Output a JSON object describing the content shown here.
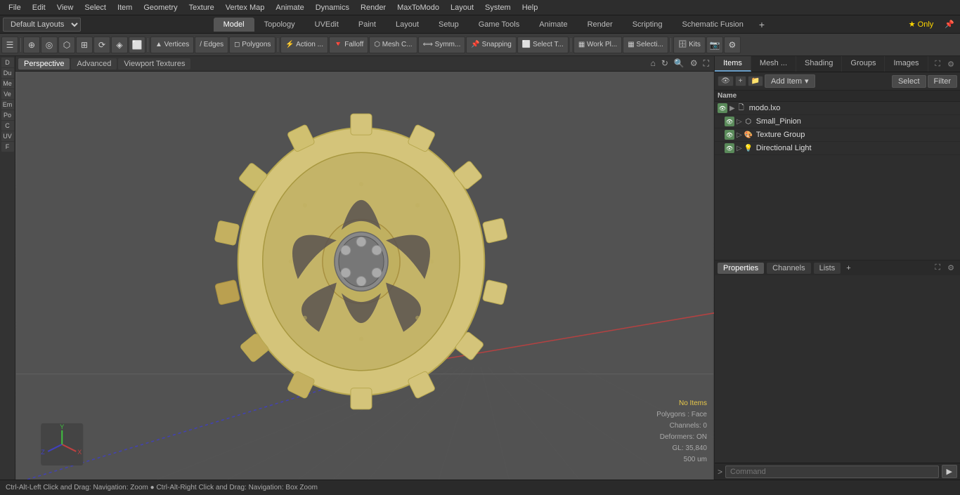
{
  "menubar": {
    "items": [
      "File",
      "Edit",
      "View",
      "Select",
      "Item",
      "Geometry",
      "Texture",
      "Vertex Map",
      "Animate",
      "Dynamics",
      "Render",
      "MaxToModo",
      "Layout",
      "System",
      "Help"
    ]
  },
  "layoutbar": {
    "preset": "Default Layouts",
    "tabs": [
      "Model",
      "Topology",
      "UVEdit",
      "Paint",
      "Layout",
      "Setup",
      "Game Tools",
      "Animate",
      "Render",
      "Scripting",
      "Schematic Fusion"
    ],
    "active_tab": "Model",
    "add_icon": "+",
    "star_label": "★ Only"
  },
  "toolbar": {
    "buttons": [
      "Vertices",
      "Edges",
      "Polygons",
      "Action ...",
      "Falloff",
      "Mesh C...",
      "Symm...",
      "Snapping",
      "Select T...",
      "Work Pl...",
      "Selecti..."
    ],
    "icons": [
      "●",
      "○",
      "◎",
      "⊕",
      "⊞",
      "⟳",
      "◈",
      "⬡",
      "⬜"
    ]
  },
  "viewport": {
    "tabs": [
      "Perspective",
      "Advanced",
      "Viewport Textures"
    ],
    "active_tab": "Perspective",
    "background_color": "#4a4a4a",
    "info": {
      "no_items": "No Items",
      "polygons": "Polygons : Face",
      "channels": "Channels: 0",
      "deformers": "Deformers: ON",
      "gl": "GL: 35,840",
      "size": "500 um"
    }
  },
  "right_panel": {
    "tabs": [
      "Items",
      "Mesh ...",
      "Shading",
      "Groups",
      "Images"
    ],
    "active_tab": "Items",
    "toolbar": {
      "add_item": "Add Item",
      "add_dropdown": "▾",
      "select": "Select",
      "filter": "Filter"
    },
    "list_header": "Name",
    "items": [
      {
        "id": "modo_lxo",
        "label": "modo.lxo",
        "icon": "cube",
        "indent": 0,
        "visibility": true,
        "expanded": true
      },
      {
        "id": "small_pinion",
        "label": "Small_Pinion",
        "icon": "mesh",
        "indent": 1,
        "visibility": true
      },
      {
        "id": "texture_group",
        "label": "Texture Group",
        "icon": "texture",
        "indent": 1,
        "visibility": true
      },
      {
        "id": "directional_light",
        "label": "Directional Light",
        "icon": "light",
        "indent": 1,
        "visibility": true
      }
    ]
  },
  "bottom_panel": {
    "tabs": [
      "Properties",
      "Channels",
      "Lists"
    ],
    "active_tab": "Properties",
    "add_icon": "+"
  },
  "statusbar": {
    "left": "Ctrl-Alt-Left Click and Drag: Navigation: Zoom  ●  Ctrl-Alt-Right Click and Drag: Navigation: Box Zoom",
    "arrow": ">",
    "command_placeholder": "Command"
  },
  "sidebar_items": [
    "D",
    "Du",
    "Me",
    "Ve",
    "Em",
    "Po",
    "C",
    "UV",
    "F"
  ]
}
